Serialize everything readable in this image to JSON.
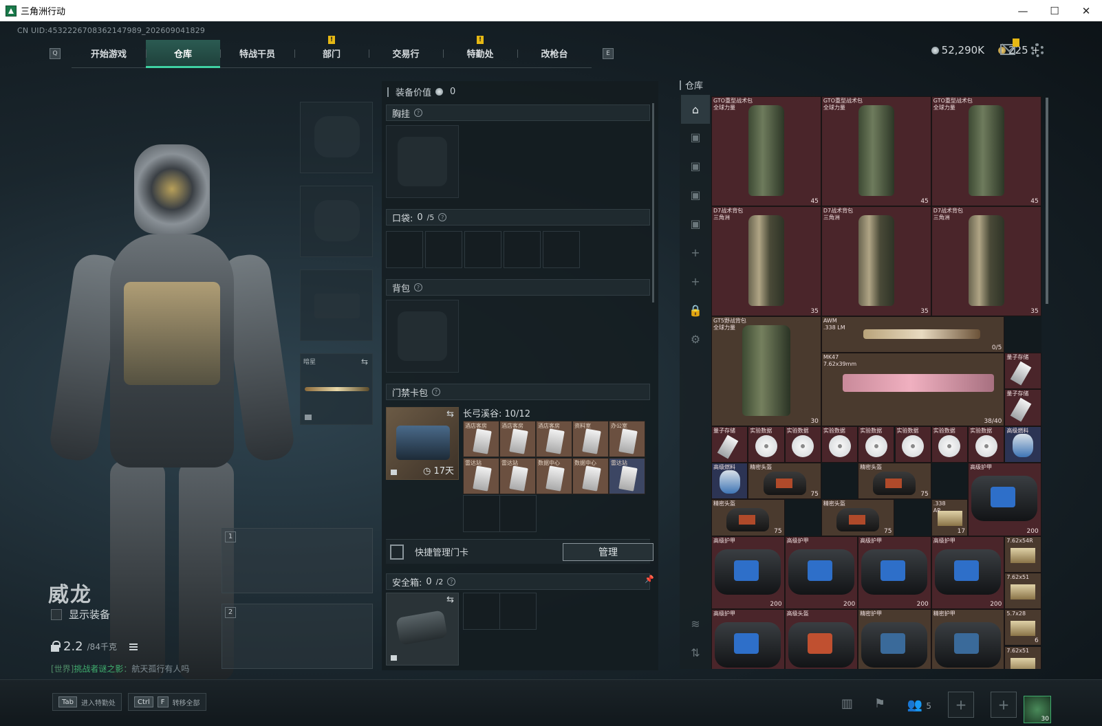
{
  "window": {
    "title": "三角洲行动",
    "min": "—",
    "max": "☐",
    "close": "✕"
  },
  "uid": "CN UID:4532226708362147989_202609041829",
  "nav": {
    "left_key": "Q",
    "right_key": "E",
    "tabs": [
      {
        "label": "开始游戏",
        "active": false,
        "badge": false
      },
      {
        "label": "仓库",
        "active": true,
        "badge": false
      },
      {
        "label": "特战干员",
        "active": false,
        "badge": false
      },
      {
        "label": "部门",
        "active": false,
        "badge": true
      },
      {
        "label": "交易行",
        "active": false,
        "badge": false
      },
      {
        "label": "特勤处",
        "active": false,
        "badge": true
      },
      {
        "label": "改枪台",
        "active": false,
        "badge": false
      }
    ],
    "badge_text": "!"
  },
  "currency": {
    "silver": "52,290K",
    "gold": "225",
    "add": "+"
  },
  "character": {
    "name": "威龙",
    "show_equipment": "显示装备",
    "weight_value": "2.2",
    "weight_capacity": "/84千克"
  },
  "chat": {
    "channel": "[世界]",
    "user": "挑战者谜之影",
    "message": "航天孤行有人吗"
  },
  "equip_slots": {
    "melee_label": "暗星",
    "weapon1_num": "1",
    "weapon2_num": "2"
  },
  "loadout": {
    "value_label": "装备价值",
    "value": "0",
    "chest_rig": "胸挂",
    "pocket_label": "口袋:",
    "pocket_count": "0",
    "pocket_capacity": "/5",
    "backpack": "背包",
    "keycard_label": "门禁卡包",
    "keycard_days": "17天",
    "keycard_map": "长弓溪谷: 10/12",
    "cards": [
      {
        "name": "酒店客房",
        "tone": "brown"
      },
      {
        "name": "酒店客房",
        "tone": "brown"
      },
      {
        "name": "酒店客房",
        "tone": "brown"
      },
      {
        "name": "资料室",
        "tone": "brown"
      },
      {
        "name": "办公室",
        "tone": "brown"
      },
      {
        "name": "雷达站",
        "tone": "brown"
      },
      {
        "name": "雷达站",
        "tone": "brown"
      },
      {
        "name": "数据中心",
        "tone": "brown"
      },
      {
        "name": "数据中心",
        "tone": "brown"
      },
      {
        "name": "雷达站",
        "tone": "blue"
      }
    ],
    "quick_manage": "快捷管理门卡",
    "manage_button": "管理",
    "safe_label": "安全箱:",
    "safe_count": "0",
    "safe_capacity": "/2"
  },
  "warehouse": {
    "title": "仓库",
    "items": [
      {
        "name": "GTO重型战术包\n全球力量",
        "count": "45",
        "color": "red",
        "kind": "bag"
      },
      {
        "name": "GTO重型战术包\n全球力量",
        "count": "45",
        "color": "red",
        "kind": "bag"
      },
      {
        "name": "GTO重型战术包\n全球力量",
        "count": "45",
        "color": "red",
        "kind": "bag"
      },
      {
        "name": "D7战术背包\n三角洲",
        "count": "35",
        "color": "red",
        "kind": "bag-light"
      },
      {
        "name": "D7战术背包\n三角洲",
        "count": "35",
        "color": "red",
        "kind": "bag-light"
      },
      {
        "name": "D7战术背包\n三角洲",
        "count": "35",
        "color": "red",
        "kind": "bag-light"
      },
      {
        "name": "GT5野战背包\n全球力量",
        "count": "30",
        "color": "brown",
        "kind": "bag-big"
      },
      {
        "name": "AWM\n.338 LM",
        "count": "0/5",
        "color": "brown",
        "kind": "gun"
      },
      {
        "name": "MK47\n7.62x39mm",
        "count": "38/40",
        "color": "brown",
        "kind": "gun-pink"
      },
      {
        "name": "量子存储",
        "count": "",
        "color": "red",
        "kind": "usb"
      },
      {
        "name": "量子存储",
        "count": "",
        "color": "red",
        "kind": "usb"
      },
      {
        "name": "量子存储",
        "count": "",
        "color": "red",
        "kind": "usb"
      },
      {
        "name": "实验数据",
        "count": "",
        "color": "red",
        "kind": "disc"
      },
      {
        "name": "实验数据",
        "count": "",
        "color": "red",
        "kind": "disc"
      },
      {
        "name": "实验数据",
        "count": "",
        "color": "red",
        "kind": "disc"
      },
      {
        "name": "实验数据",
        "count": "",
        "color": "red",
        "kind": "disc"
      },
      {
        "name": "实验数据",
        "count": "",
        "color": "red",
        "kind": "disc"
      },
      {
        "name": "实验数据",
        "count": "",
        "color": "red",
        "kind": "disc"
      },
      {
        "name": "实验数据",
        "count": "",
        "color": "red",
        "kind": "disc"
      },
      {
        "name": "高级燃料",
        "count": "",
        "color": "blue",
        "kind": "canister"
      },
      {
        "name": "高级燃料",
        "count": "",
        "color": "blue",
        "kind": "canister"
      },
      {
        "name": "精密头盔",
        "count": "75",
        "color": "brown",
        "kind": "helmet"
      },
      {
        "name": "精密头盔",
        "count": "75",
        "color": "brown",
        "kind": "helmet"
      },
      {
        "name": "精密头盔",
        "count": "75",
        "color": "brown",
        "kind": "helmet"
      },
      {
        "name": "精密头盔",
        "count": "75",
        "color": "brown",
        "kind": "helmet"
      },
      {
        "name": ".338\nAP",
        "count": "17",
        "color": "brown",
        "kind": "ammo"
      },
      {
        "name": "高级护甲",
        "count": "200",
        "color": "red",
        "kind": "armor"
      },
      {
        "name": "高级护甲",
        "count": "200",
        "color": "red",
        "kind": "armor"
      },
      {
        "name": "高级护甲",
        "count": "200",
        "color": "red",
        "kind": "armor"
      },
      {
        "name": "高级护甲",
        "count": "200",
        "color": "red",
        "kind": "armor"
      },
      {
        "name": "高级护甲",
        "count": "200",
        "color": "red",
        "kind": "armor"
      },
      {
        "name": "7.62x54R",
        "count": "",
        "color": "brown",
        "kind": "ammo"
      },
      {
        "name": "7.62x51",
        "count": "",
        "color": "brown",
        "kind": "ammo"
      },
      {
        "name": "高级护甲",
        "count": "",
        "color": "red",
        "kind": "armor"
      },
      {
        "name": "高级头盔",
        "count": "",
        "color": "red",
        "kind": "armor-red"
      },
      {
        "name": "精密护甲",
        "count": "",
        "color": "brown",
        "kind": "armor-dark"
      },
      {
        "name": "精密护甲",
        "count": "",
        "color": "brown",
        "kind": "armor-dark"
      },
      {
        "name": "5.7x28",
        "count": "6",
        "color": "brown",
        "kind": "ammo"
      },
      {
        "name": "7.62x51",
        "count": "",
        "color": "brown",
        "kind": "ammo"
      }
    ]
  },
  "bottom": {
    "tab_key": "Tab",
    "tab_action": "进入特勤处",
    "ctrl_key": "Ctrl",
    "f_key": "F",
    "ctrl_action": "转移全部",
    "friends": "5",
    "avatar_level": "30"
  },
  "colors": {
    "accent": "#3fd2a2",
    "badge": "#e6b814",
    "red_rarity": "#4a252a",
    "blue_rarity": "#2c3454"
  }
}
